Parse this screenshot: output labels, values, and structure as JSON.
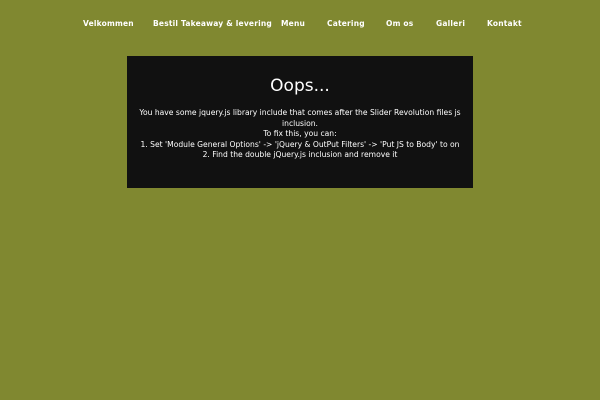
{
  "nav": {
    "items": [
      {
        "label": "Velkommen"
      },
      {
        "label": "Bestil Takeaway & levering"
      },
      {
        "label": "Menu"
      },
      {
        "label": "Catering"
      },
      {
        "label": "Om os"
      },
      {
        "label": "Galleri"
      },
      {
        "label": "Kontakt"
      }
    ]
  },
  "error": {
    "title": "Oops...",
    "line1": "You have some jquery.js library include that comes after the Slider Revolution files js",
    "line2": "inclusion.",
    "line3": "To fix this, you can:",
    "line4": "1. Set 'Module General Options' -> 'jQuery & OutPut Filters' -> 'Put JS to Body' to on",
    "line5": "2. Find the double jQuery.js inclusion and remove it"
  },
  "colors": {
    "background": "#808830",
    "error_box": "#111111",
    "text": "#ffffff"
  }
}
